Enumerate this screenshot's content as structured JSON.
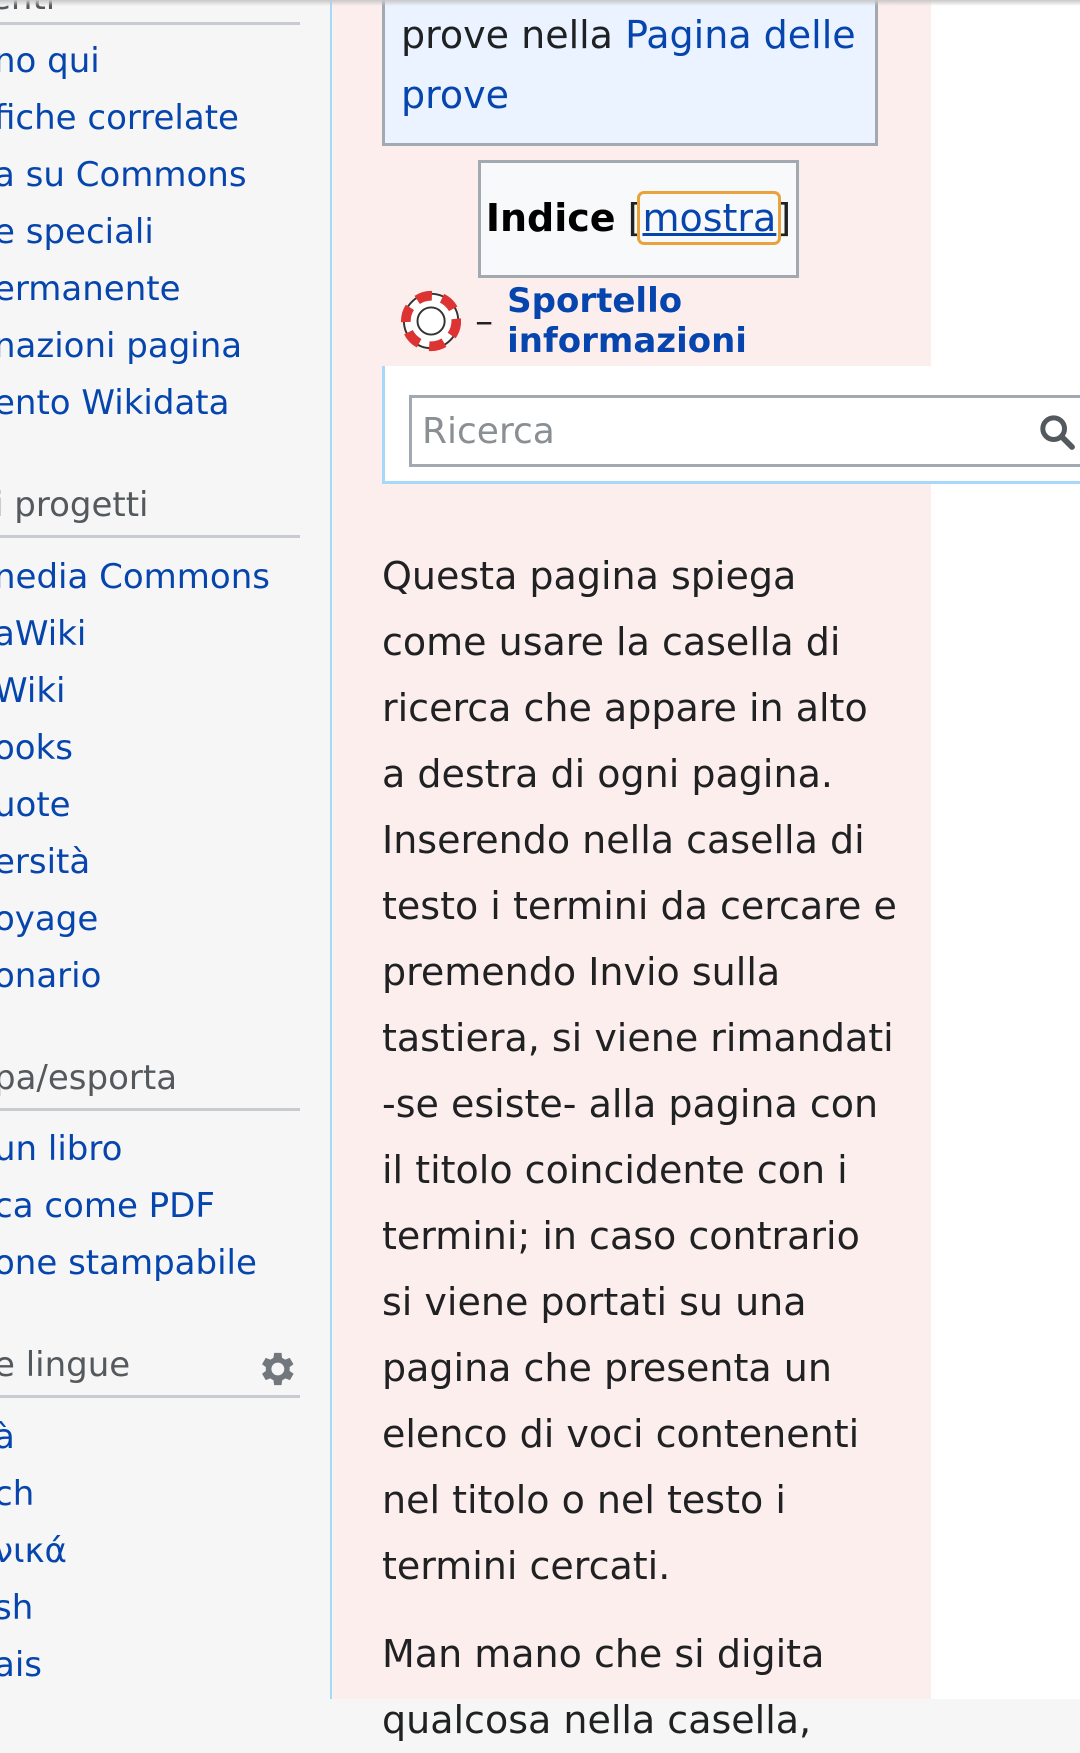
{
  "sidebar": {
    "portals": [
      {
        "heading": "",
        "items": [
          "no qui",
          "fiche correlate",
          "a su Commons",
          "e speciali",
          "ermanente",
          "nazioni pagina",
          "ento Wikidata"
        ]
      },
      {
        "heading": "i progetti",
        "items": [
          "nedia Commons",
          "aWiki",
          "Wiki",
          "ooks",
          "uote",
          "ersità",
          "oyage",
          "onario"
        ]
      },
      {
        "heading": "pa/esporta",
        "items": [
          "un libro",
          "ca come PDF",
          "one stampabile"
        ]
      },
      {
        "heading": "e lingue",
        "items": [
          "à",
          "ch",
          "νικά",
          "sh",
          "ais"
        ]
      }
    ],
    "top_partial_heading": "enti"
  },
  "notebox": {
    "text_before": "prove nella ",
    "link": "Pagina delle prove"
  },
  "toc": {
    "title": "Indice",
    "bracket_open": "[",
    "toggle": "mostra",
    "bracket_close": "]"
  },
  "help": {
    "dash": "–",
    "link": "Sportello informazioni"
  },
  "search": {
    "placeholder": "Ricerca"
  },
  "body": {
    "p1": "Questa pagina spiega come usare la casella di ricerca che appare in alto a destra di ogni pagina. Inserendo nella casella di testo i termini da cercare e premendo Invio sulla tastiera, si viene rimandati -se esiste- alla pagina con il titolo coincidente con i termini; in caso contrario si viene portati su una pagina che presenta un elenco di voci contenenti nel titolo o nel testo i termini cercati.",
    "p2": "Man mano che si digita qualcosa nella casella,"
  },
  "icons": {
    "lifebuoy": "lifebuoy-icon",
    "gear": "gear-icon",
    "search": "search-icon"
  },
  "colors": {
    "link": "#0645ad",
    "content_bg": "#fdeeee",
    "notebox_bg": "#eaf3ff",
    "toc_focus": "#e8a33c",
    "sidebar_bg": "#f6f6f6"
  }
}
